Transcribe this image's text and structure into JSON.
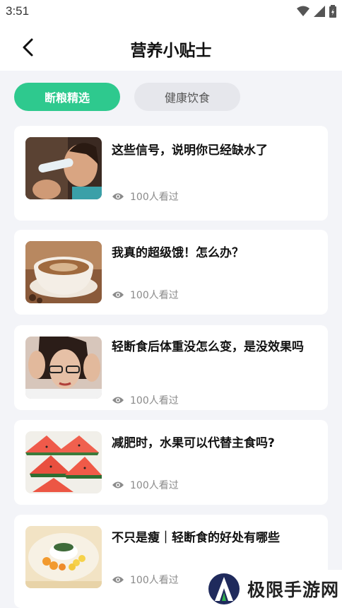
{
  "status": {
    "time": "3:51"
  },
  "header": {
    "title": "营养小贴士"
  },
  "tabs": [
    {
      "label": "断粮精选",
      "active": true
    },
    {
      "label": "健康饮食",
      "active": false
    }
  ],
  "articles": [
    {
      "title": "这些信号，说明你已经缺水了",
      "views": "100人看过",
      "image": "woman-drinking-water"
    },
    {
      "title": "我真的超级饿！怎么办？",
      "views": "100人看过",
      "image": "coffee-cup"
    },
    {
      "title": "轻断食后体重没怎么变，是没效果吗",
      "views": "100人看过",
      "image": "stressed-woman"
    },
    {
      "title": "减肥时，水果可以代替主食吗?",
      "views": "100人看过",
      "image": "watermelon-slices"
    },
    {
      "title": "不只是瘦｜轻断食的好处有哪些",
      "views": "100人看过",
      "image": "rice-dish"
    }
  ],
  "watermark": {
    "text": "极限手游网"
  },
  "colors": {
    "accent": "#2ec98e",
    "background": "#f3f4f8"
  }
}
